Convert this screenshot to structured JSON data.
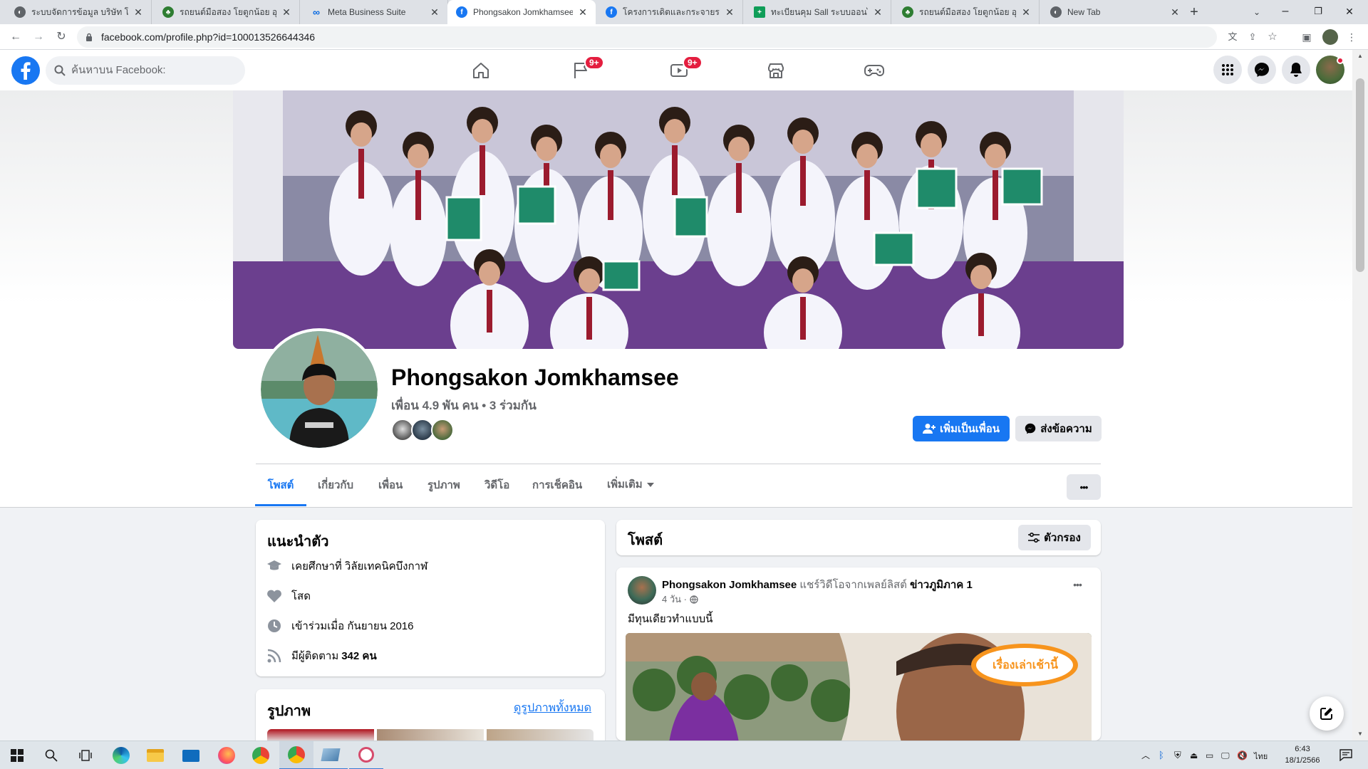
{
  "browser": {
    "tabs": [
      {
        "title": "ระบบจัดการข้อมูล บริษัท โยตูก",
        "favicon": "globe-icon",
        "active": false
      },
      {
        "title": "รถยนต์มือสอง โยตูกน้อย อุดร",
        "favicon": "leaf-icon",
        "active": false
      },
      {
        "title": "Meta Business Suite",
        "favicon": "meta-icon",
        "active": false
      },
      {
        "title": "Phongsakon Jomkhamsee",
        "favicon": "facebook-icon",
        "active": true
      },
      {
        "title": "โครงการเดิตและกระจายรถยนต์",
        "favicon": "facebook-icon",
        "active": false
      },
      {
        "title": "ทะเบียนคุม Sall ระบบออนไลน์",
        "favicon": "sheets-icon",
        "active": false
      },
      {
        "title": "รถยนต์มือสอง โยตูกน้อย อุดร",
        "favicon": "leaf-icon",
        "active": false
      },
      {
        "title": "New Tab",
        "favicon": "globe-icon",
        "active": false
      }
    ],
    "url": "facebook.com/profile.php?id=100013526644346"
  },
  "fb": {
    "search_placeholder": "ค้นหาบน Facebook:",
    "nav_badges": {
      "pages": "9+",
      "watch": "9+"
    }
  },
  "profile": {
    "name": "Phongsakon Jomkhamsee",
    "friends_text": "เพื่อน 4.9 พัน คน • 3 ร่วมกัน",
    "add_friend_label": "เพิ่มเป็นเพื่อน",
    "message_label": "ส่งข้อความ",
    "more_label": "•••",
    "tabs": [
      "โพสต์",
      "เกี่ยวกับ",
      "เพื่อน",
      "รูปภาพ",
      "วิดีโอ",
      "การเช็คอิน",
      "เพิ่มเติม"
    ]
  },
  "intro": {
    "title": "แนะนำตัว",
    "items": [
      {
        "icon": "graduation-cap-icon",
        "text": "เคยศึกษาที่ วิลัยเทคนิคบึงกาฬ"
      },
      {
        "icon": "heart-icon",
        "text": "โสด"
      },
      {
        "icon": "clock-icon",
        "text": "เข้าร่วมเมื่อ กันยายน 2016"
      },
      {
        "icon": "rss-icon",
        "text": "มีผู้ติดตาม ",
        "bold": "342 คน"
      }
    ]
  },
  "photos": {
    "title": "รูปภาพ",
    "see_all": "ดูรูปภาพทั้งหมด"
  },
  "posts_header": {
    "title": "โพสต์",
    "filter_label": "ตัวกรอง"
  },
  "post": {
    "author": "Phongsakon Jomkhamsee",
    "action": " แชร์วิดีโอจากเพลย์ลิสต์ ",
    "target": "ข่าวภูมิภาค 1",
    "time": "4 วัน ·",
    "text": "มีทุนเดียวทำแบบนี้",
    "video_logo": "เรื่องเล่าเช้านี้"
  },
  "taskbar": {
    "time": "6:43",
    "date": "18/1/2566",
    "lang": "ไทย"
  },
  "colors": {
    "facebook_blue": "#1877f2",
    "badge_red": "#e41e3f",
    "page_bg": "#f0f2f5"
  }
}
